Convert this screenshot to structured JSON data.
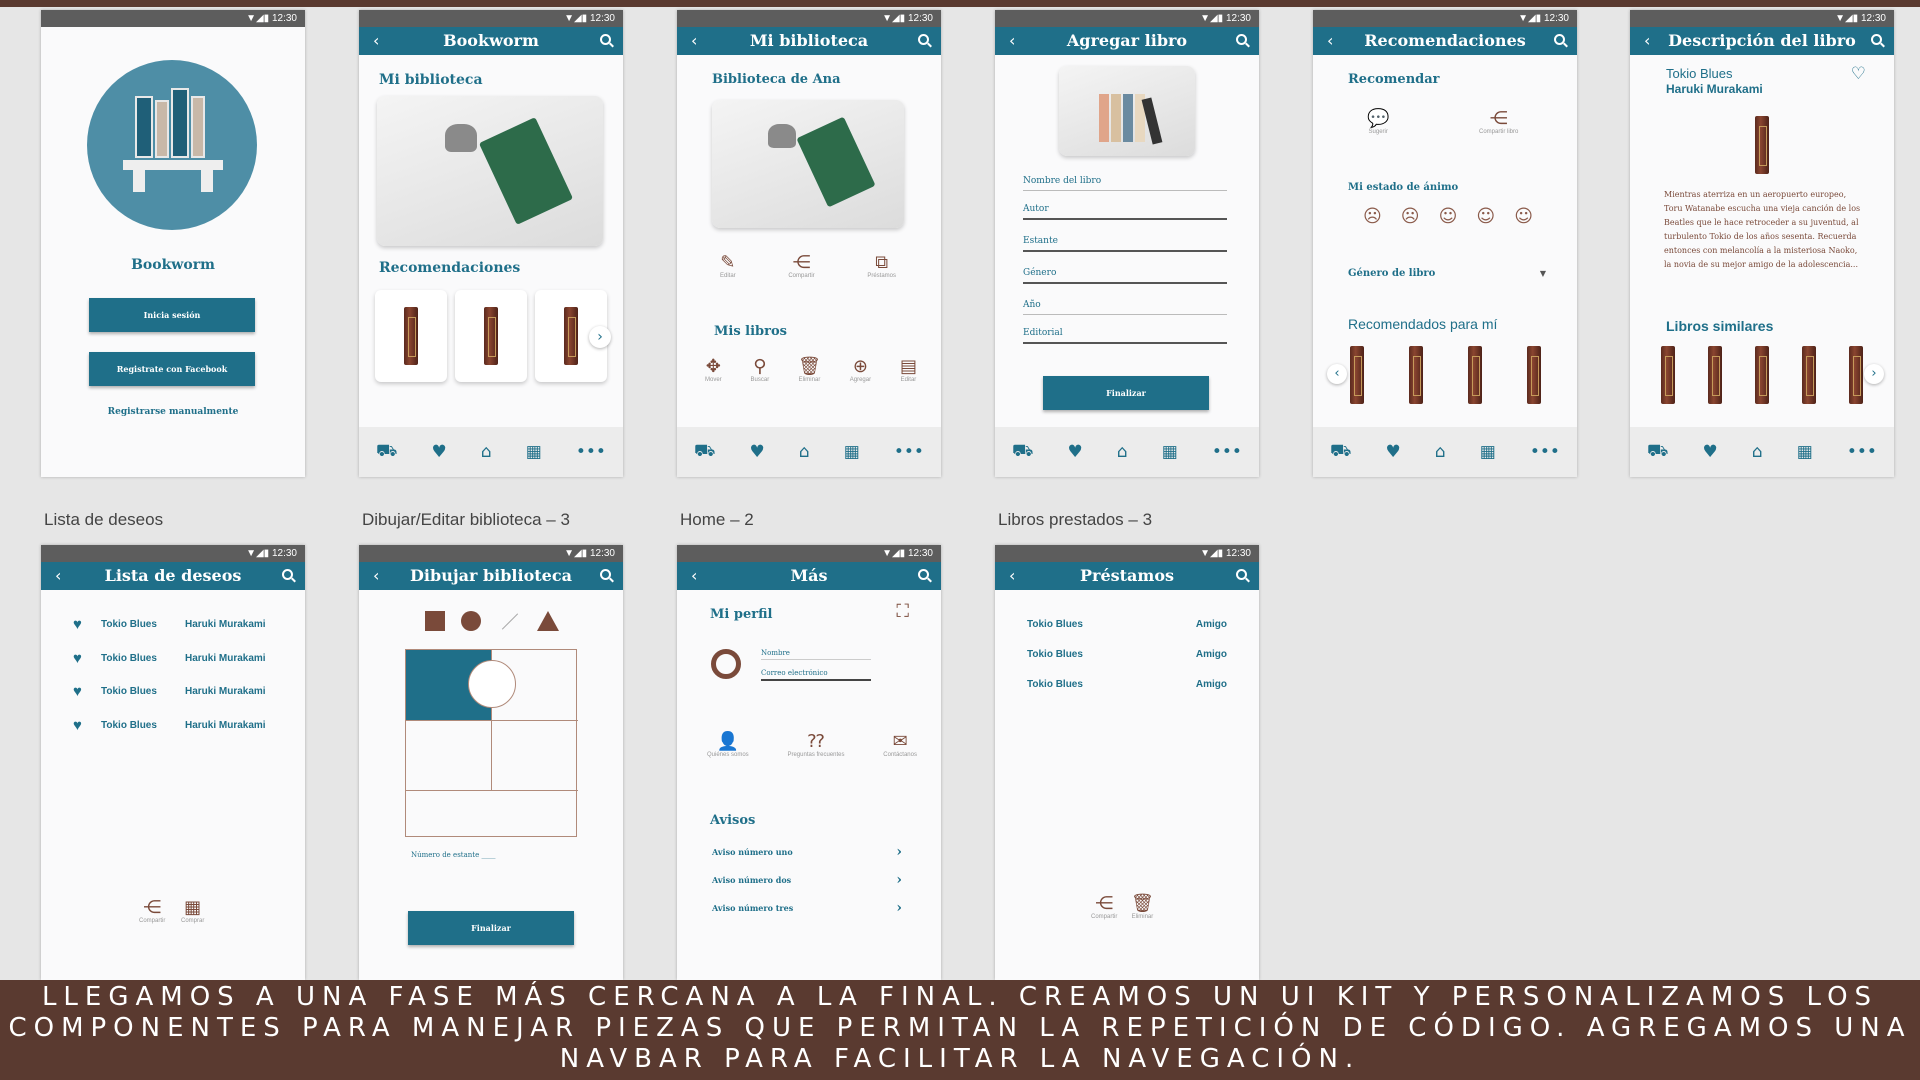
{
  "status_time": "12:30",
  "labels": {
    "wishlist": "Lista de deseos",
    "draw": "Dibujar/Editar biblioteca – 3",
    "home2": "Home – 2",
    "loans": "Libros prestados – 3"
  },
  "login": {
    "app_name": "Bookworm",
    "login_button": "Inicia sesión",
    "facebook_button": "Registrate con Facebook",
    "manual_link": "Registrarse manualmente"
  },
  "home": {
    "title": "Bookworm",
    "my_library": "Mi biblioteca",
    "recommendations": "Recomendaciones"
  },
  "library": {
    "title": "Mi biblioteca",
    "heading": "Biblioteca de Ana",
    "actions": [
      "Editar",
      "Compartir",
      "Préstamos"
    ],
    "my_books": "Mis libros",
    "book_actions": [
      "Mover",
      "Buscar",
      "Eliminar",
      "Agregar",
      "Editar"
    ]
  },
  "add_book": {
    "title": "Agregar libro",
    "fields": [
      "Nombre del libro",
      "Autor",
      "Estante",
      "Género",
      "Año",
      "Editorial"
    ],
    "finish": "Finalizar"
  },
  "recs": {
    "title": "Recomendaciones",
    "recommend": "Recomendar",
    "rec_actions": [
      "Sugerir",
      "Compartir libro"
    ],
    "mood": "Mi estado de ánimo",
    "genre": "Género de libro",
    "for_me": "Recomendados para mí"
  },
  "desc": {
    "title": "Descripción del libro",
    "book_title": "Tokio Blues",
    "author": "Haruki Murakami",
    "synopsis": "Mientras aterriza en un aeropuerto europeo, Toru Watanabe escucha una vieja canción de los Beatles que le hace retroceder a su juventud, al turbulento Tokio de los años sesenta. Recuerda entonces con melancolía a la misteriosa Naoko, la novia de su mejor amigo de la adolescencia...",
    "similar": "Libros similares"
  },
  "wishlist": {
    "title": "Lista de deseos",
    "items": [
      {
        "book": "Tokio Blues",
        "author": "Haruki Murakami"
      },
      {
        "book": "Tokio Blues",
        "author": "Haruki Murakami"
      },
      {
        "book": "Tokio Blues",
        "author": "Haruki Murakami"
      },
      {
        "book": "Tokio Blues",
        "author": "Haruki Murakami"
      }
    ],
    "actions": [
      "Compartir",
      "Comprar"
    ]
  },
  "draw": {
    "title": "Dibujar biblioteca",
    "shelf_number": "Número de estante",
    "finish": "Finalizar"
  },
  "more": {
    "title": "Más",
    "profile": "Mi perfil",
    "name_field": "Nombre",
    "email_field": "Correo electrónico",
    "options": [
      "Quiénes somos",
      "Preguntas frecuentes",
      "Contáctanos"
    ],
    "notices": "Avisos",
    "notice_items": [
      "Aviso número uno",
      "Aviso número dos",
      "Aviso número tres"
    ]
  },
  "loans": {
    "title": "Préstamos",
    "items": [
      {
        "book": "Tokio Blues",
        "to": "Amigo"
      },
      {
        "book": "Tokio Blues",
        "to": "Amigo"
      },
      {
        "book": "Tokio Blues",
        "to": "Amigo"
      }
    ],
    "actions": [
      "Compartir",
      "Eliminar"
    ]
  },
  "caption": "LLEGAMOS A UNA FASE MÁS CERCANA A LA FINAL. CREAMOS UN UI KIT Y PERSONALIZAMOS LOS COMPONENTES PARA MANEJAR PIEZAS QUE PERMITAN LA REPETICIÓN DE CÓDIGO. AGREGAMOS UNA NAVBAR PARA FACILITAR LA NAVEGACIÓN.",
  "colors": {
    "primary": "#1f6f89",
    "accent": "#7a4a3a",
    "caption_bg": "#5a3a30"
  }
}
